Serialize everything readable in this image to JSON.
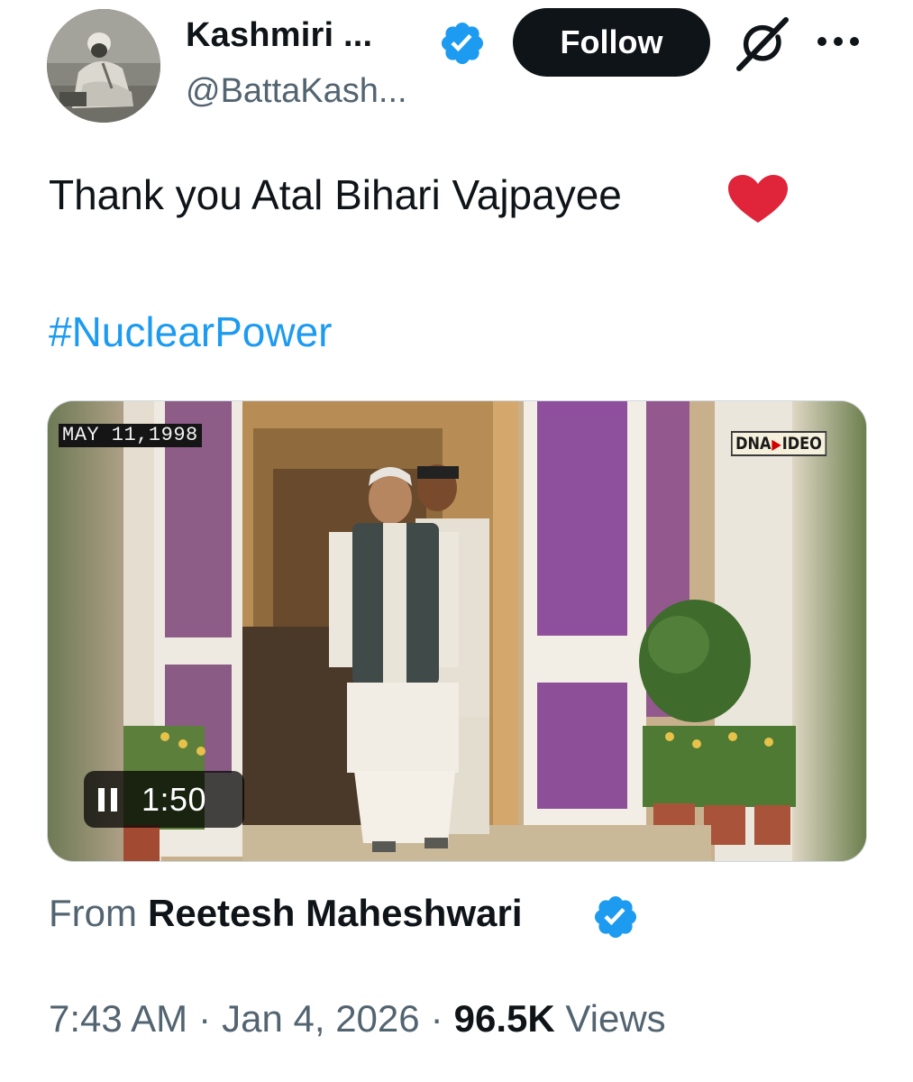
{
  "header": {
    "display_name": "Kashmiri ...",
    "handle": "@BattaKash...",
    "follow_label": "Follow",
    "verified": true
  },
  "tweet": {
    "text": "Thank you Atal Bihari Vajpayee",
    "emoji": "red-heart",
    "hashtag": "#NuclearPower"
  },
  "video": {
    "date_stamp": "MAY 11,1998",
    "channel_logo_left": "DNA",
    "channel_logo_right": "IDEO",
    "duration": "1:50",
    "state": "playing"
  },
  "attribution": {
    "from_label": "From",
    "author": "Reetesh Maheshwari",
    "verified": true
  },
  "meta": {
    "time": "7:43 AM",
    "separator": "·",
    "date": "Jan 4, 2026",
    "views_count": "96.5K",
    "views_label": "Views"
  },
  "colors": {
    "link": "#1d9bf0",
    "verified": "#1d9bf0",
    "primary_text": "#0f1419",
    "secondary_text": "#536471",
    "follow_bg": "#0f1419",
    "heart": "#e0243a"
  },
  "icons": [
    "verified-badge-icon",
    "grok-icon",
    "more-options-icon",
    "heart-emoji-icon",
    "pause-icon"
  ]
}
